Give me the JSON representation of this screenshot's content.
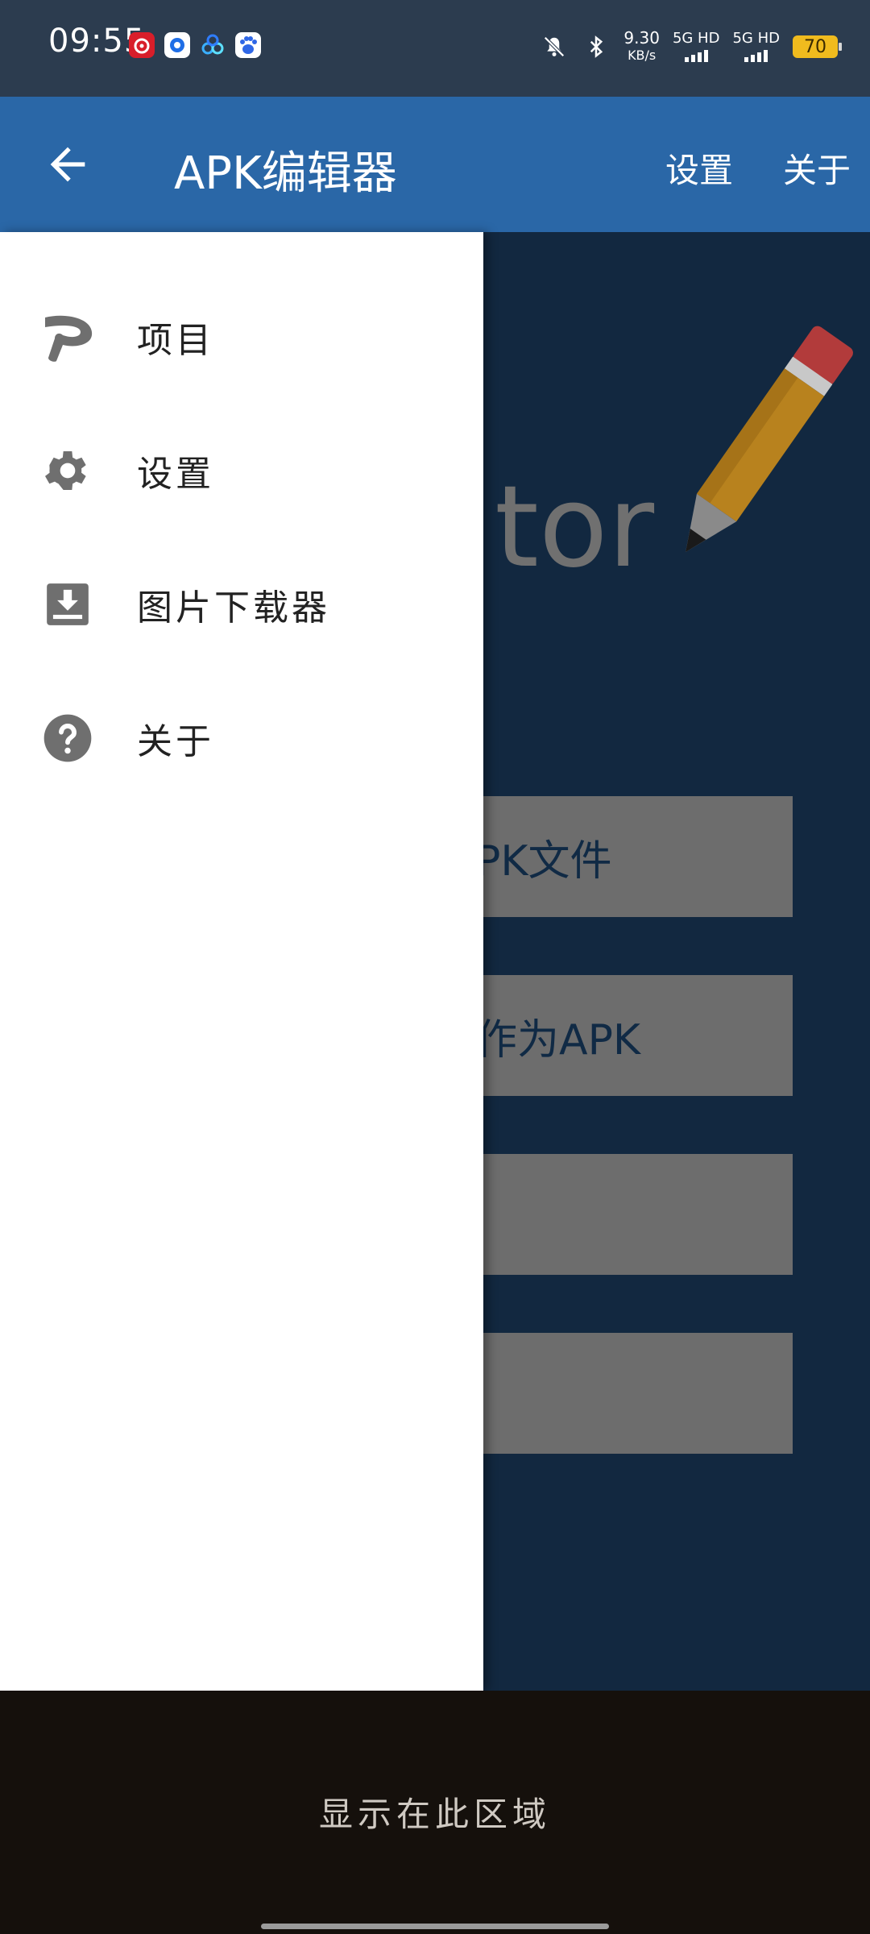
{
  "status_bar": {
    "time": "09:55",
    "speed_value": "9.30",
    "speed_unit": "KB/s",
    "sim1": "5G HD",
    "sim2": "5G HD",
    "battery": "70",
    "icons": [
      "netease-music-icon",
      "blue-app-icon",
      "baidu-netdisk-icon",
      "baidu-icon",
      "mute-bell-icon",
      "bluetooth-icon"
    ]
  },
  "app_bar": {
    "title": "APK编辑器",
    "action_settings": "设置",
    "action_about": "关于"
  },
  "drawer": {
    "items": [
      {
        "label": "项目",
        "icon": "project-icon"
      },
      {
        "label": "设置",
        "icon": "gear-icon"
      },
      {
        "label": "图片下载器",
        "icon": "image-download-icon"
      },
      {
        "label": "关于",
        "icon": "help-icon"
      }
    ]
  },
  "background_content": {
    "logo_text": "tor",
    "buttons": [
      {
        "label": "PK文件"
      },
      {
        "label": "作为APK"
      },
      {
        "label": ""
      },
      {
        "label": ""
      }
    ]
  },
  "bottom_area": {
    "text": "显示在此区域"
  },
  "colors": {
    "status_bar": "#2c3c4f",
    "app_bar": "#2a67a7",
    "content_bg": "#122840",
    "drawer_bg": "#ffffff",
    "icon_gray": "#6f6f6f",
    "button_gray": "#6d6d6d",
    "bottom_bg": "#15100c"
  }
}
